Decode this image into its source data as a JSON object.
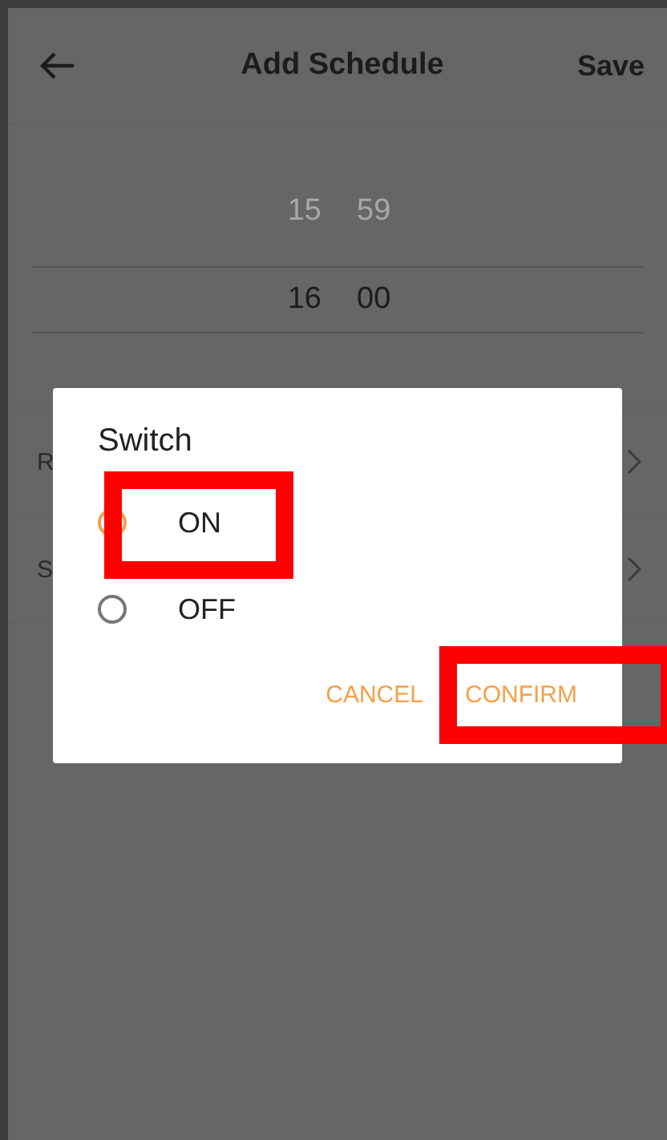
{
  "header": {
    "title": "Add Schedule",
    "action": "Save"
  },
  "time_picker": {
    "rows": [
      {
        "hour": "15",
        "minute": "59",
        "selected": false
      },
      {
        "hour": "16",
        "minute": "00",
        "selected": true
      }
    ]
  },
  "settings_rows": [
    {
      "label": "R"
    },
    {
      "label": "S"
    }
  ],
  "dialog": {
    "title": "Switch",
    "options": [
      {
        "label": "ON",
        "selected": true,
        "highlighted": true
      },
      {
        "label": "OFF",
        "selected": false,
        "highlighted": false
      }
    ],
    "buttons": [
      {
        "label": "CANCEL",
        "highlighted": false
      },
      {
        "label": "CONFIRM",
        "highlighted": true
      }
    ]
  }
}
